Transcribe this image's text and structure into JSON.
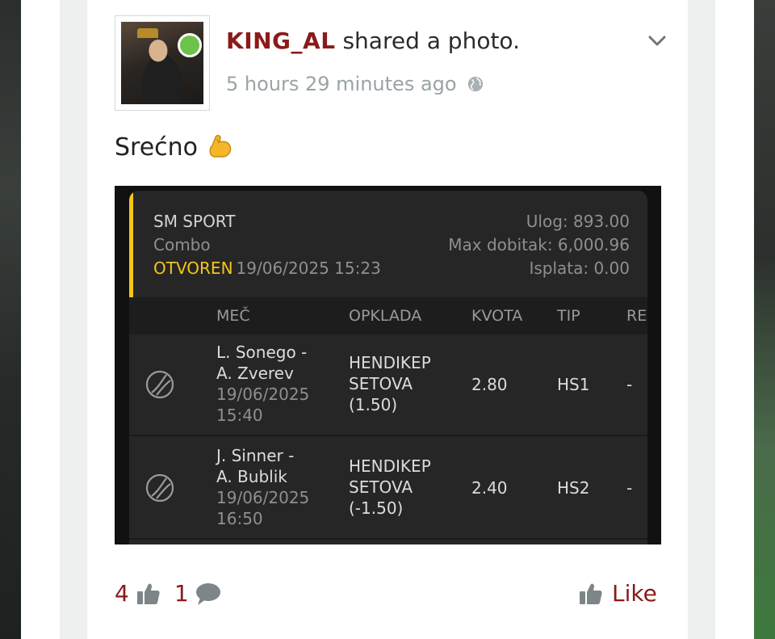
{
  "post": {
    "username": "KING_AL",
    "action": " shared a photo.",
    "timestamp": "5 hours 29 minutes ago",
    "text": "Srećno",
    "online": true
  },
  "slip": {
    "bookmaker": "SM SPORT",
    "type": "Combo",
    "status": "OTVOREN",
    "datetime": "19/06/2025 15:23",
    "stake": "Ulog: 893.00",
    "max_win": "Max dobitak: 6,000.96",
    "payout": "Isplata: 0.00",
    "columns": [
      "MEČ",
      "OPKLADA",
      "KVOTA",
      "TIP",
      "RE"
    ],
    "rows": [
      {
        "player1": "L. Sonego -",
        "player2": "A. Zverev",
        "date": "19/06/2025",
        "time": "15:40",
        "bet_line1": "HENDIKEP",
        "bet_line2": "SETOVA",
        "bet_line3": "(1.50)",
        "odd": "2.80",
        "tip": "HS1",
        "result": "-"
      },
      {
        "player1": "J. Sinner -",
        "player2": "A. Bublik",
        "date": "19/06/2025",
        "time": "16:50",
        "bet_line1": "HENDIKEP",
        "bet_line2": "SETOVA",
        "bet_line3": "(-1.50)",
        "odd": "2.40",
        "tip": "HS2",
        "result": "-"
      }
    ]
  },
  "footer": {
    "likes_count": "4",
    "comments_count": "1",
    "like_label": "Like"
  },
  "colors": {
    "brand": "#8b1a1a",
    "status_open": "#f5c518",
    "online": "#6cc24a"
  },
  "icons": [
    "avatar",
    "chevron-down-icon",
    "globe-icon",
    "flexed-biceps-icon",
    "tennis-ball-icon",
    "thumbs-up-icon",
    "comment-icon"
  ]
}
